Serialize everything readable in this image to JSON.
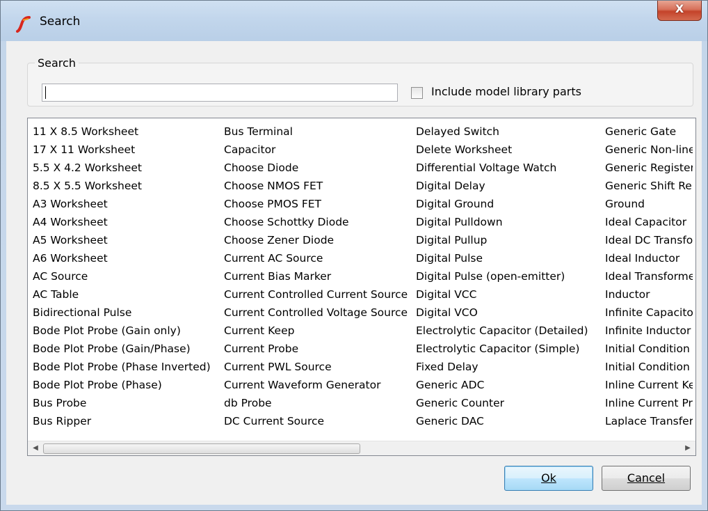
{
  "window": {
    "title": "Search",
    "close_label": "X",
    "accent": "#c4432a"
  },
  "search_group": {
    "label": "Search",
    "input_value": "",
    "include_label": "Include model library parts",
    "include_checked": false
  },
  "results": {
    "columns": [
      [
        "11 X 8.5 Worksheet",
        "17 X 11 Worksheet",
        "5.5 X 4.2 Worksheet",
        "8.5 X 5.5 Worksheet",
        "A3 Worksheet",
        "A4 Worksheet",
        "A5 Worksheet",
        "A6 Worksheet",
        "AC Source",
        "AC Table",
        "Bidirectional Pulse",
        "Bode Plot Probe (Gain only)",
        "Bode Plot Probe (Gain/Phase)",
        "Bode Plot Probe (Phase Inverted)",
        "Bode Plot Probe (Phase)",
        "Bus Probe",
        "Bus Ripper"
      ],
      [
        "Bus Terminal",
        "Capacitor",
        "Choose Diode",
        "Choose NMOS FET",
        "Choose PMOS FET",
        "Choose Schottky Diode",
        "Choose Zener Diode",
        "Current AC Source",
        "Current Bias Marker",
        "Current Controlled Current Source",
        "Current Controlled Voltage Source",
        "Current Keep",
        "Current Probe",
        "Current PWL Source",
        "Current Waveform Generator",
        "db Probe",
        "DC Current Source"
      ],
      [
        "Delayed Switch",
        "Delete Worksheet",
        "Differential Voltage Watch",
        "Digital Delay",
        "Digital Ground",
        "Digital Pulldown",
        "Digital Pullup",
        "Digital Pulse",
        "Digital Pulse (open-emitter)",
        "Digital VCC",
        "Digital VCO",
        "Electrolytic Capacitor (Detailed)",
        "Electrolytic Capacitor (Simple)",
        "Fixed Delay",
        "Generic ADC",
        "Generic Counter",
        "Generic DAC"
      ],
      [
        "Generic Gate",
        "Generic Non-line",
        "Generic Register",
        "Generic Shift Re",
        "Ground",
        "Ideal Capacitor",
        "Ideal DC Transfo",
        "Ideal Inductor",
        "Ideal Transforme",
        "Inductor",
        "Infinite Capacitor",
        "Infinite Inductor",
        "Initial Condition",
        "Initial Condition -",
        "Inline Current Ke",
        "Inline Current Pro",
        "Laplace Transfer"
      ]
    ],
    "scroll_left_icon": "scroll-left-arrow",
    "scroll_right_icon": "scroll-right-arrow"
  },
  "buttons": {
    "ok_label": "Ok",
    "cancel_label": "Cancel"
  }
}
